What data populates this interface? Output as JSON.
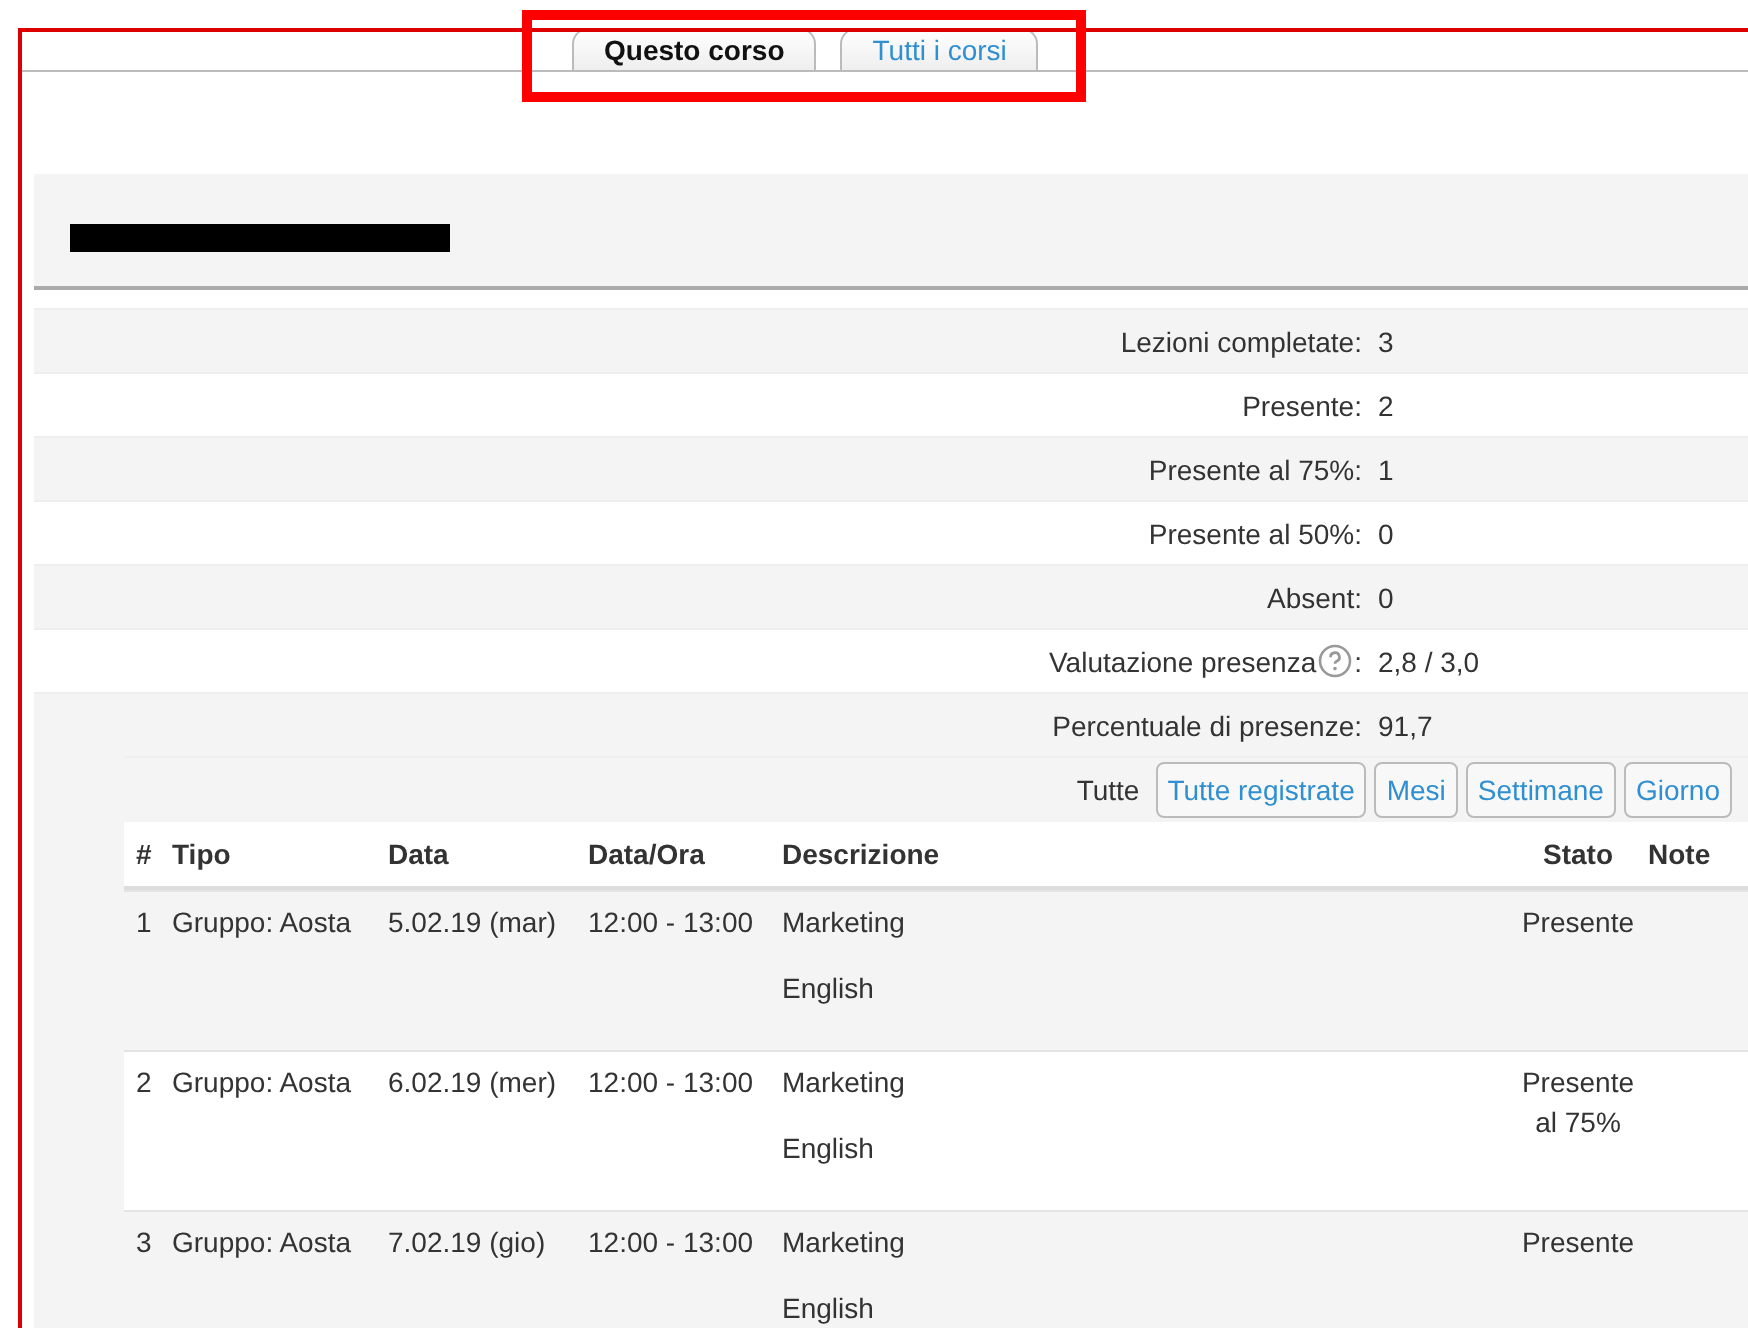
{
  "tabs": [
    {
      "label": "Questo corso",
      "selected": true
    },
    {
      "label": "Tutti i corsi",
      "selected": false
    }
  ],
  "heading": {
    "redacted": true
  },
  "summary": [
    {
      "label": "Lezioni completate:",
      "value": "3"
    },
    {
      "label": "Presente:",
      "value": "2"
    },
    {
      "label": "Presente al 75%:",
      "value": "1"
    },
    {
      "label": "Presente al 50%:",
      "value": "0"
    },
    {
      "label": "Absent:",
      "value": "0"
    },
    {
      "label": "Valutazione presenza",
      "help": true,
      "suffix": ":",
      "value": "2,8 / 3,0"
    },
    {
      "label": "Percentuale di presenze:",
      "value": "91,7"
    }
  ],
  "filters": [
    {
      "label": "Tutte",
      "selected": true
    },
    {
      "label": "Tutte registrate",
      "selected": false
    },
    {
      "label": "Mesi",
      "selected": false
    },
    {
      "label": "Settimane",
      "selected": false
    },
    {
      "label": "Giorno",
      "selected": false
    }
  ],
  "table": {
    "columns": [
      "#",
      "Tipo",
      "Data",
      "Data/Ora",
      "Descrizione",
      "Stato",
      "Note"
    ],
    "rows": [
      {
        "cells": [
          "1",
          "Gruppo: Aosta",
          "5.02.19 (mar)",
          "12:00 - 13:00"
        ],
        "description": [
          "Marketing",
          "English"
        ],
        "status": [
          "Presente"
        ]
      },
      {
        "cells": [
          "2",
          "Gruppo: Aosta",
          "6.02.19 (mer)",
          "12:00 - 13:00"
        ],
        "description": [
          "Marketing",
          "English"
        ],
        "status": [
          "Presente",
          "al 75%"
        ]
      },
      {
        "cells": [
          "3",
          "Gruppo: Aosta",
          "7.02.19 (gio)",
          "12:00 - 13:00"
        ],
        "description": [
          "Marketing",
          "English"
        ],
        "status": [
          "Presente"
        ]
      }
    ]
  }
}
